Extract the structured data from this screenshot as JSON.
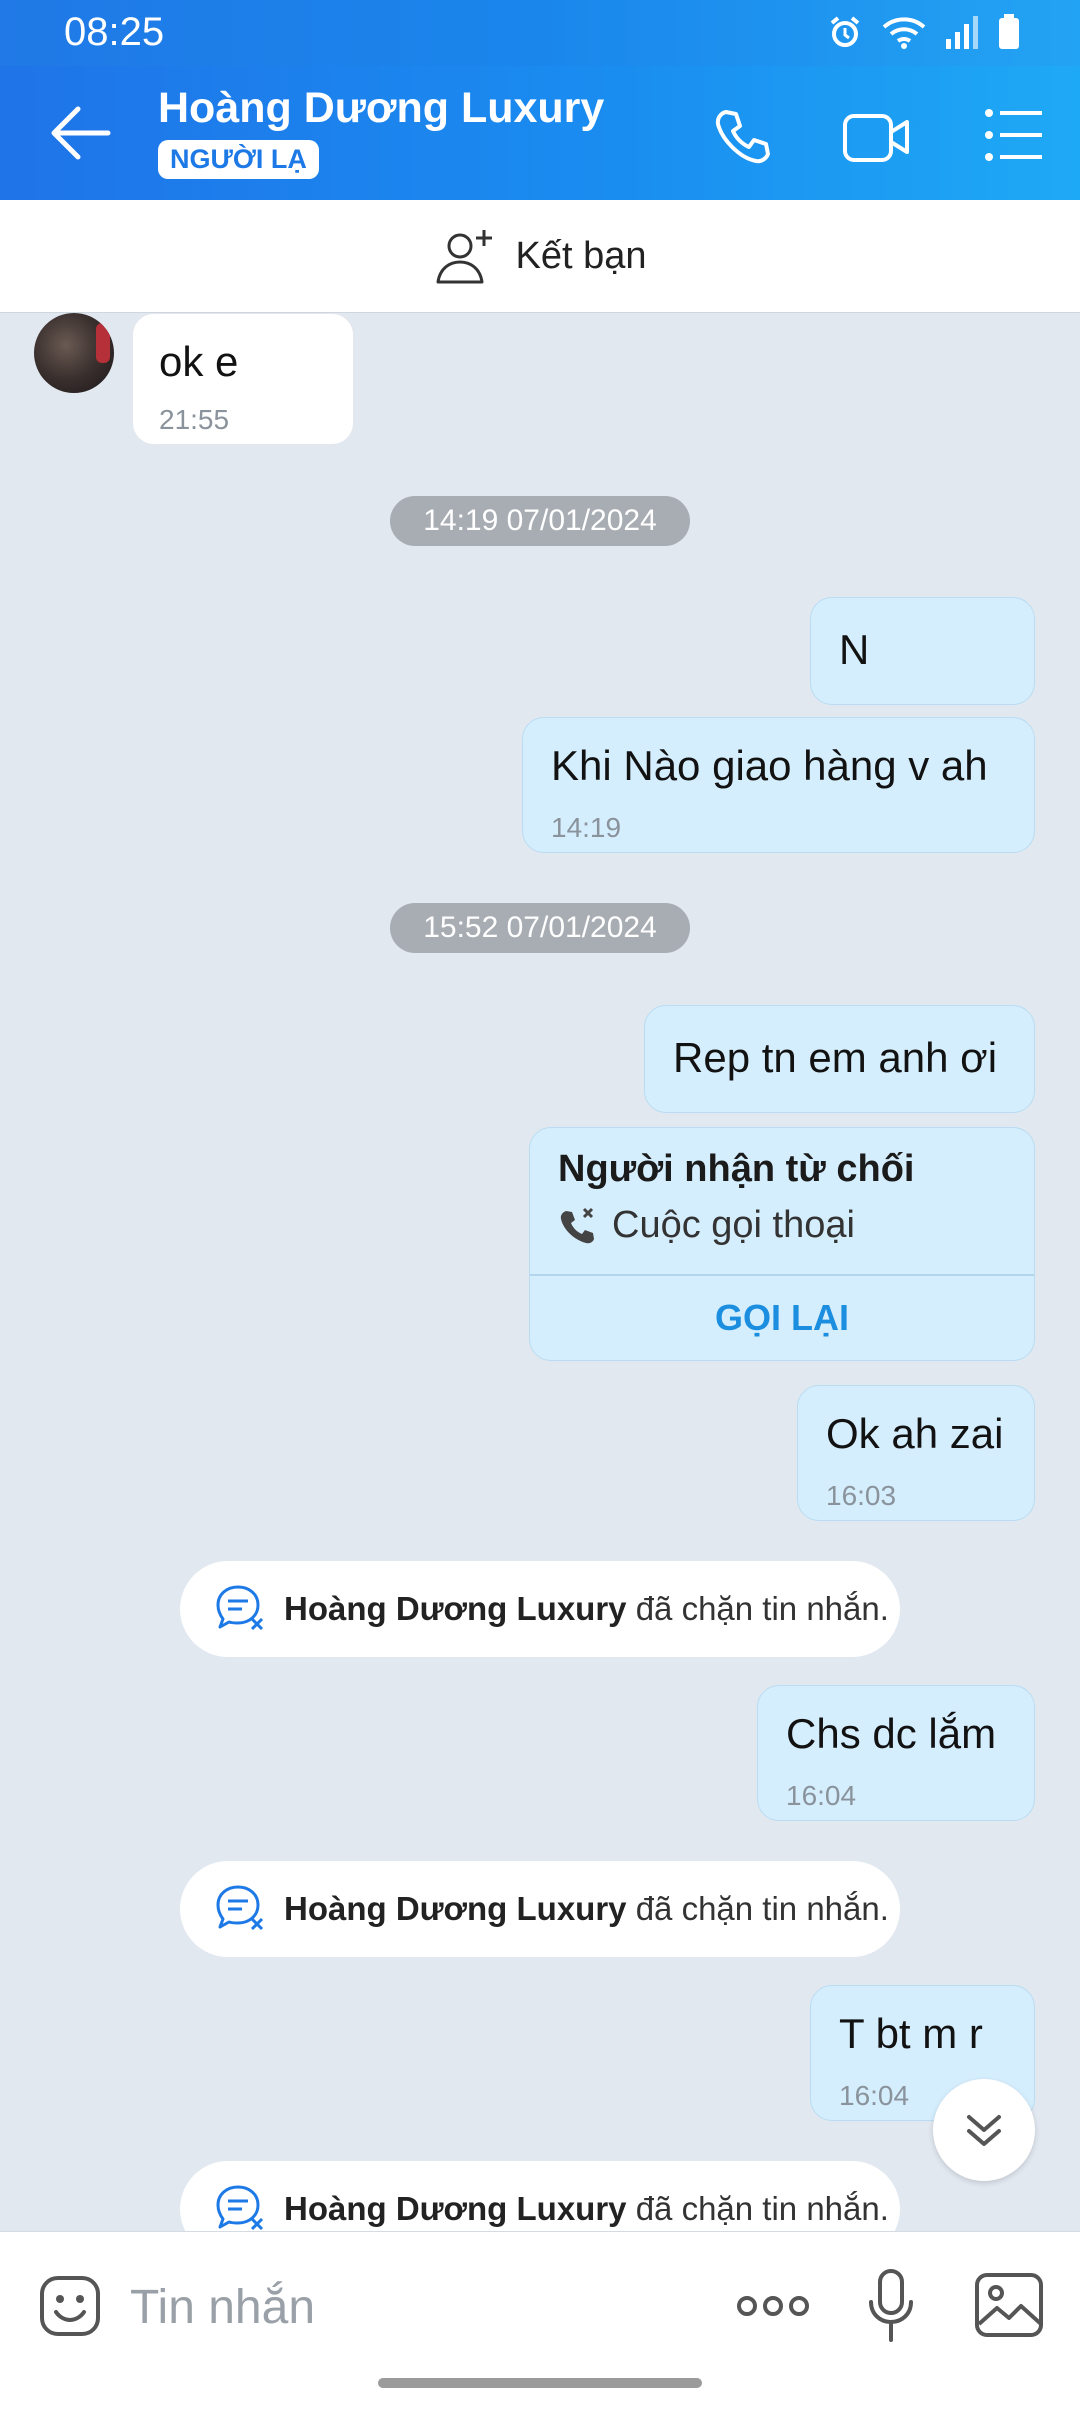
{
  "status": {
    "time": "08:25"
  },
  "header": {
    "title": "Hoàng Dương Luxury",
    "badge": "NGƯỜI LẠ"
  },
  "add_friend": {
    "label": "Kết bạn"
  },
  "messages": {
    "m1": {
      "text": "ok e",
      "time": "21:55"
    },
    "date1": "14:19 07/01/2024",
    "m2": {
      "text": "N"
    },
    "m3": {
      "text": "Khi Nào giao hàng v ah",
      "time": "14:19"
    },
    "date2": "15:52 07/01/2024",
    "m4": {
      "text": "Rep tn em anh ơi"
    },
    "call": {
      "title": "Người nhận từ chối",
      "subtitle": "Cuộc gọi thoại",
      "button": "GỌI LẠI"
    },
    "m5": {
      "text": "Ok ah zai",
      "time": "16:03"
    },
    "notice": {
      "name": "Hoàng Dương Luxury",
      "text": "đã chặn tin nhắn."
    },
    "m6": {
      "text": "Chs dc lắm",
      "time": "16:04"
    },
    "m7": {
      "text": "T bt m r",
      "time": "16:04"
    }
  },
  "input": {
    "placeholder": "Tin nhắn"
  },
  "colors": {
    "header_start": "#1f74e8",
    "header_end": "#1ea9f5",
    "bubble_out": "#d5eefd",
    "chat_bg": "#e2e8f0",
    "accent": "#1c8ee0"
  }
}
